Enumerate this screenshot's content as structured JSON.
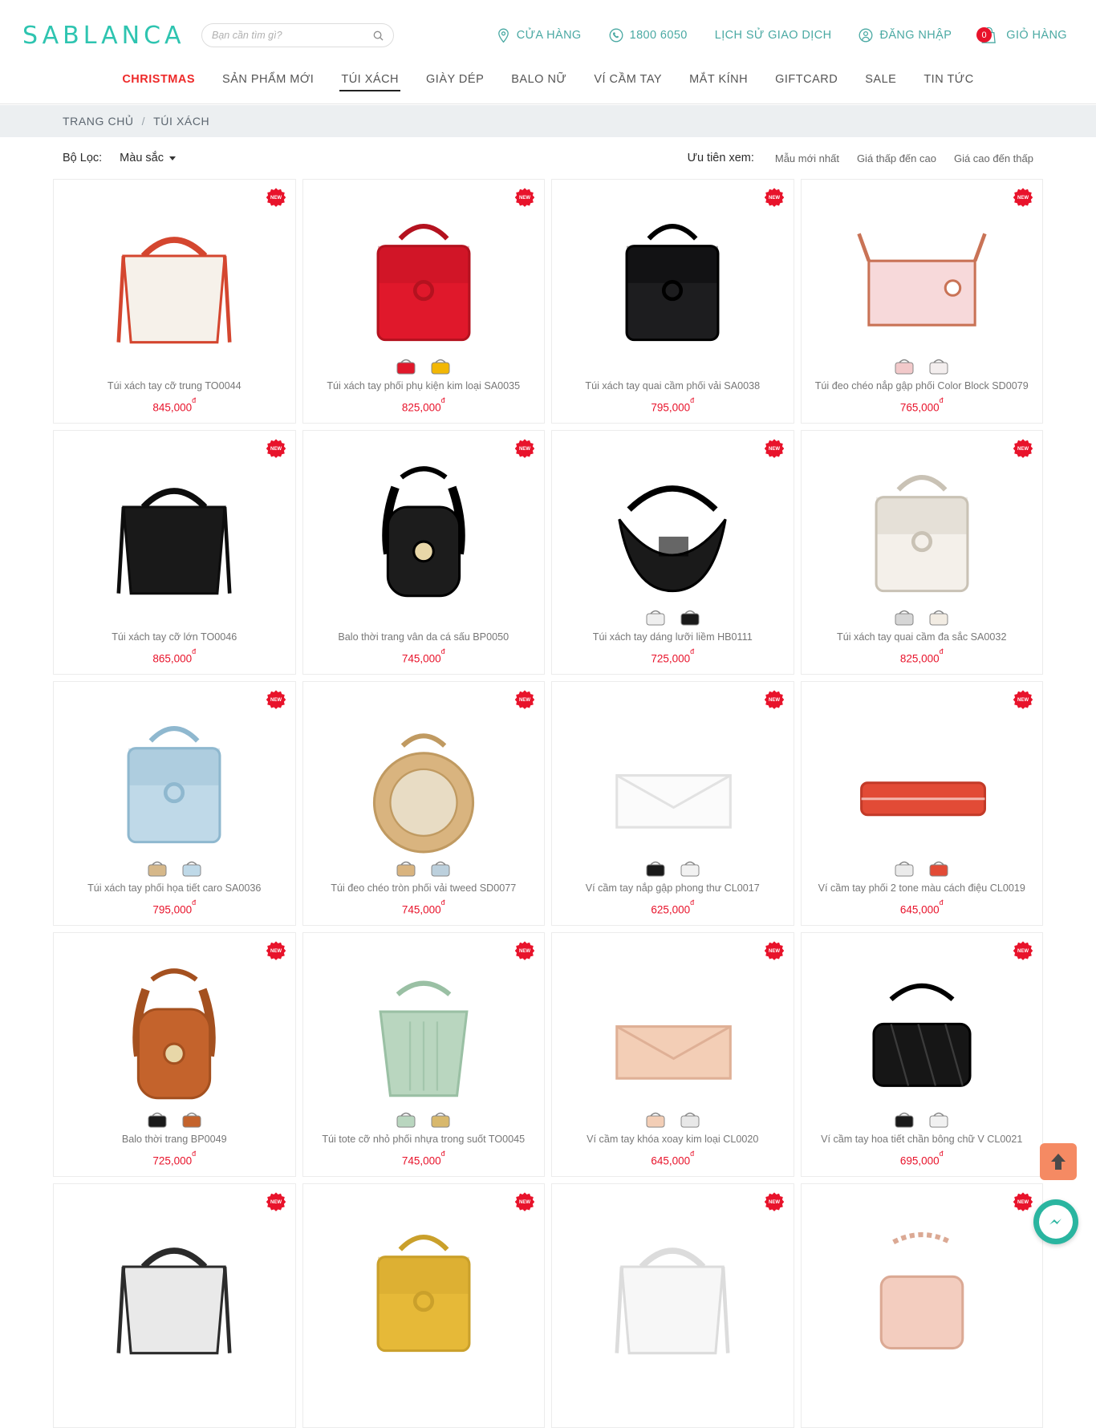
{
  "brand": {
    "logo_text": "SABLANCA",
    "accent": "#2ec4b0",
    "price_color": "#e8132b"
  },
  "search": {
    "placeholder": "Bạn cần tìm gì?",
    "value": "",
    "icon": "search-icon"
  },
  "header_links": [
    {
      "label": "CỬA HÀNG",
      "icon": "location-pin-icon"
    },
    {
      "label": "1800 6050",
      "icon": "phone-icon"
    },
    {
      "label": "LỊCH SỬ GIAO DỊCH",
      "icon": ""
    },
    {
      "label": "ĐĂNG NHẬP",
      "icon": "user-icon"
    },
    {
      "label": "GIỎ HÀNG",
      "icon": "cart-icon",
      "count": "0"
    }
  ],
  "nav": [
    {
      "label": "CHRISTMAS",
      "style": "red"
    },
    {
      "label": "SẢN PHẨM MỚI",
      "style": ""
    },
    {
      "label": "TÚI XÁCH",
      "style": "active"
    },
    {
      "label": "GIÀY DÉP",
      "style": ""
    },
    {
      "label": "BALO NỮ",
      "style": ""
    },
    {
      "label": "VÍ CẦM TAY",
      "style": ""
    },
    {
      "label": "MẮT KÍNH",
      "style": ""
    },
    {
      "label": "GIFTCARD",
      "style": ""
    },
    {
      "label": "SALE",
      "style": ""
    },
    {
      "label": "TIN TỨC",
      "style": ""
    }
  ],
  "breadcrumb": {
    "home": "TRANG CHỦ",
    "sep": "/",
    "current": "TÚI XÁCH"
  },
  "filter": {
    "label": "Bộ Lọc:",
    "color_select": "Màu sắc",
    "sort_label": "Ưu tiên xem:",
    "sort_options": [
      "Mẫu mới nhất",
      "Giá thấp đến cao",
      "Giá cao đến thấp"
    ]
  },
  "badge_new_text": "NEW",
  "products": [
    {
      "name": "Túi xách tay cỡ trung TO0044",
      "price": "845,000",
      "currency": "đ",
      "new": true,
      "body": "#f6f1ea",
      "trim": "#d4462f",
      "shape": "tote",
      "swatches": []
    },
    {
      "name": "Túi xách tay phối phụ kiện kim loại SA0035",
      "price": "825,000",
      "currency": "đ",
      "new": true,
      "body": "#e0182b",
      "trim": "#b4121f",
      "shape": "flap",
      "swatches": [
        "#e0182b",
        "#f2b705"
      ]
    },
    {
      "name": "Túi xách tay quai cầm phối vải SA0038",
      "price": "795,000",
      "currency": "đ",
      "new": true,
      "body": "#1d1d1f",
      "trim": "#000000",
      "shape": "flap",
      "swatches": []
    },
    {
      "name": "Túi đeo chéo nắp gập phối Color Block SD0079",
      "price": "765,000",
      "currency": "đ",
      "new": true,
      "body": "#f7d9da",
      "trim": "#c97356",
      "shape": "crossbody",
      "swatches": [
        "#f2c9ca",
        "#f3eeee"
      ]
    },
    {
      "name": "Túi xách tay cỡ lớn TO0046",
      "price": "865,000",
      "currency": "đ",
      "new": true,
      "body": "#191919",
      "trim": "#0d0d0d",
      "shape": "tote",
      "swatches": []
    },
    {
      "name": "Balo thời trang vân da cá sấu BP0050",
      "price": "745,000",
      "currency": "đ",
      "new": true,
      "body": "#1c1c1c",
      "trim": "#000000",
      "shape": "backpack",
      "swatches": []
    },
    {
      "name": "Túi xách tay dáng lưỡi liềm HB0111",
      "price": "725,000",
      "currency": "đ",
      "new": true,
      "body": "#1a1a1a",
      "trim": "#000000",
      "shape": "hobo",
      "swatches": [
        "#efefef",
        "#1a1a1a"
      ]
    },
    {
      "name": "Túi xách tay quai cầm đa sắc SA0032",
      "price": "825,000",
      "currency": "đ",
      "new": true,
      "body": "#f4f0ea",
      "trim": "#c9c2b5",
      "shape": "flap",
      "swatches": [
        "#d6d6d6",
        "#f2ece3"
      ]
    },
    {
      "name": "Túi xách tay phối họa tiết caro SA0036",
      "price": "795,000",
      "currency": "đ",
      "new": true,
      "body": "#bfd9e8",
      "trim": "#8fb8cf",
      "shape": "flap",
      "swatches": [
        "#d6b88a",
        "#bfd9e8"
      ]
    },
    {
      "name": "Túi đeo chéo tròn phối vải tweed SD0077",
      "price": "745,000",
      "currency": "đ",
      "new": true,
      "body": "#d9b47f",
      "trim": "#c09a61",
      "shape": "round",
      "swatches": [
        "#d9b47f",
        "#bcd0dd"
      ]
    },
    {
      "name": "Ví cầm tay nắp gập phong thư CL0017",
      "price": "625,000",
      "currency": "đ",
      "new": true,
      "body": "#fbfbfb",
      "trim": "#e2e2e2",
      "shape": "clutch",
      "swatches": [
        "#1a1a1a",
        "#f2f2f2"
      ]
    },
    {
      "name": "Ví cầm tay phối 2 tone màu cách điệu CL0019",
      "price": "645,000",
      "currency": "đ",
      "new": true,
      "body": "#e24b36",
      "trim": "#c23a28",
      "shape": "slimclutch",
      "swatches": [
        "#ebebeb",
        "#e24b36"
      ]
    },
    {
      "name": "Balo thời trang BP0049",
      "price": "725,000",
      "currency": "đ",
      "new": true,
      "body": "#c4632c",
      "trim": "#a4501f",
      "shape": "backpack",
      "swatches": [
        "#1a1a1a",
        "#c4632c"
      ]
    },
    {
      "name": "Túi tote cỡ nhỏ phối nhựa trong suốt TO0045",
      "price": "745,000",
      "currency": "đ",
      "new": true,
      "body": "#b9d6bf",
      "trim": "#9ac0a4",
      "shape": "bucket",
      "swatches": [
        "#b9d6bf",
        "#d8b86c"
      ]
    },
    {
      "name": "Ví cầm tay khóa xoay kim loại CL0020",
      "price": "645,000",
      "currency": "đ",
      "new": true,
      "body": "#f3ceb6",
      "trim": "#dfb096",
      "shape": "clutch",
      "swatches": [
        "#f3ceb6",
        "#e8e8e8"
      ]
    },
    {
      "name": "Ví cầm tay hoa tiết chần bông chữ V CL0021",
      "price": "695,000",
      "currency": "đ",
      "new": true,
      "body": "#161616",
      "trim": "#000000",
      "shape": "quilt",
      "swatches": [
        "#1a1a1a",
        "#f1f1f1"
      ]
    },
    {
      "name": "",
      "price": "",
      "currency": "",
      "new": true,
      "body": "#e9e9e9",
      "trim": "#2b2b2b",
      "shape": "tote",
      "swatches": []
    },
    {
      "name": "",
      "price": "",
      "currency": "",
      "new": true,
      "body": "#e6b938",
      "trim": "#caa02b",
      "shape": "flap",
      "swatches": []
    },
    {
      "name": "",
      "price": "",
      "currency": "",
      "new": true,
      "body": "#f7f7f7",
      "trim": "#dcdcdc",
      "shape": "tote",
      "swatches": []
    },
    {
      "name": "",
      "price": "",
      "currency": "",
      "new": true,
      "body": "#f3cdbf",
      "trim": "#dba994",
      "shape": "chain",
      "swatches": []
    }
  ],
  "floating": {
    "scroll_top_icon": "arrow-up-icon",
    "messenger_icon": "messenger-icon"
  }
}
